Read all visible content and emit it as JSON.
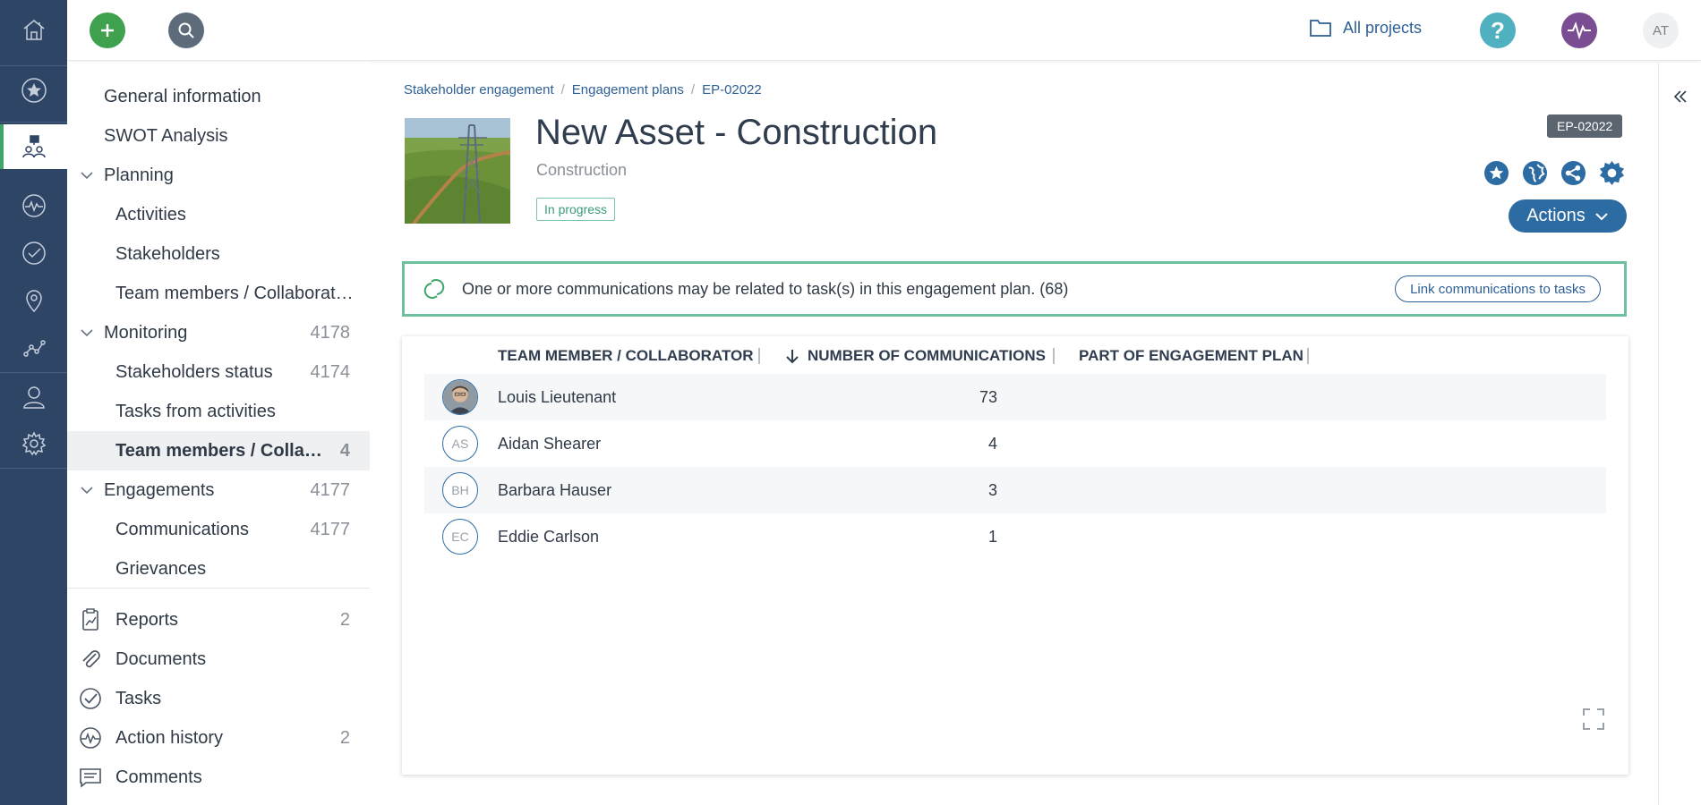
{
  "topbar": {
    "projects_label": "All projects",
    "user_initials": "AT"
  },
  "subnav": {
    "items": [
      {
        "label": "General information",
        "count": ""
      },
      {
        "label": "SWOT Analysis",
        "count": ""
      },
      {
        "label": "Planning",
        "count": ""
      },
      {
        "label": "Activities",
        "count": ""
      },
      {
        "label": "Stakeholders",
        "count": ""
      },
      {
        "label": "Team members / Collaborat…",
        "count": ""
      },
      {
        "label": "Monitoring",
        "count": "4178"
      },
      {
        "label": "Stakeholders status",
        "count": "4174"
      },
      {
        "label": "Tasks from activities",
        "count": ""
      },
      {
        "label": "Team members / Collab…",
        "count": "4"
      },
      {
        "label": "Engagements",
        "count": "4177"
      },
      {
        "label": "Communications",
        "count": "4177"
      },
      {
        "label": "Grievances",
        "count": ""
      },
      {
        "label": "Reports",
        "count": "2"
      },
      {
        "label": "Documents",
        "count": ""
      },
      {
        "label": "Tasks",
        "count": ""
      },
      {
        "label": "Action history",
        "count": "2"
      },
      {
        "label": "Comments",
        "count": ""
      }
    ]
  },
  "breadcrumb": [
    "Stakeholder engagement",
    "Engagement plans",
    "EP-02022"
  ],
  "header": {
    "title": "New Asset - Construction",
    "subtitle": "Construction",
    "status": "In progress",
    "id_badge": "EP-02022",
    "actions_label": "Actions"
  },
  "notice": {
    "text": "One or more communications may be related to task(s) in this engagement plan. (68)",
    "button": "Link communications to tasks"
  },
  "table": {
    "columns": [
      "TEAM MEMBER / COLLABORATOR",
      "NUMBER OF COMMUNICATIONS",
      "PART OF ENGAGEMENT PLAN"
    ],
    "rows": [
      {
        "initials": "",
        "name": "Louis Lieutenant",
        "count": "73",
        "photo": true
      },
      {
        "initials": "AS",
        "name": "Aidan Shearer",
        "count": "4"
      },
      {
        "initials": "BH",
        "name": "Barbara Hauser",
        "count": "3"
      },
      {
        "initials": "EC",
        "name": "Eddie Carlson",
        "count": "1"
      }
    ]
  },
  "colors": {
    "rail": "#2f4566",
    "accent_blue": "#2d6ba3",
    "green": "#3fa66b",
    "notice_border": "#6dc19e"
  },
  "icons": {
    "rail": [
      "home-icon",
      "star-icon",
      "stakeholder-icon",
      "activity-icon",
      "check-icon",
      "location-icon",
      "analytics-icon",
      "user-icon",
      "gear-icon"
    ],
    "header": [
      "star-icon",
      "globe-icon",
      "share-icon",
      "gear-icon"
    ]
  }
}
